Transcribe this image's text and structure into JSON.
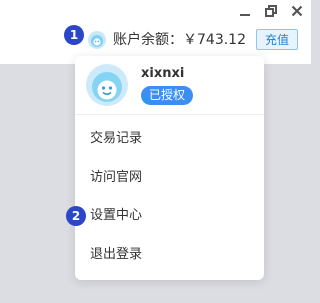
{
  "window_controls": {
    "minimize_icon": "minimize-icon",
    "restore_icon": "restore-icon",
    "close_icon": "close-icon"
  },
  "markers": [
    "1",
    "2"
  ],
  "header": {
    "balance_label": "账户余额：",
    "balance_value": "￥743.12",
    "recharge_label": "充值"
  },
  "profile": {
    "username": "xixnxi",
    "status_badge": "已授权"
  },
  "menu": {
    "items": [
      {
        "label": "交易记录"
      },
      {
        "label": "访问官网"
      },
      {
        "label": "设置中心"
      },
      {
        "label": "退出登录"
      }
    ]
  },
  "colors": {
    "accent": "#3c8ef3",
    "marker": "#2b46c8",
    "backdrop": "#dcdde3"
  }
}
